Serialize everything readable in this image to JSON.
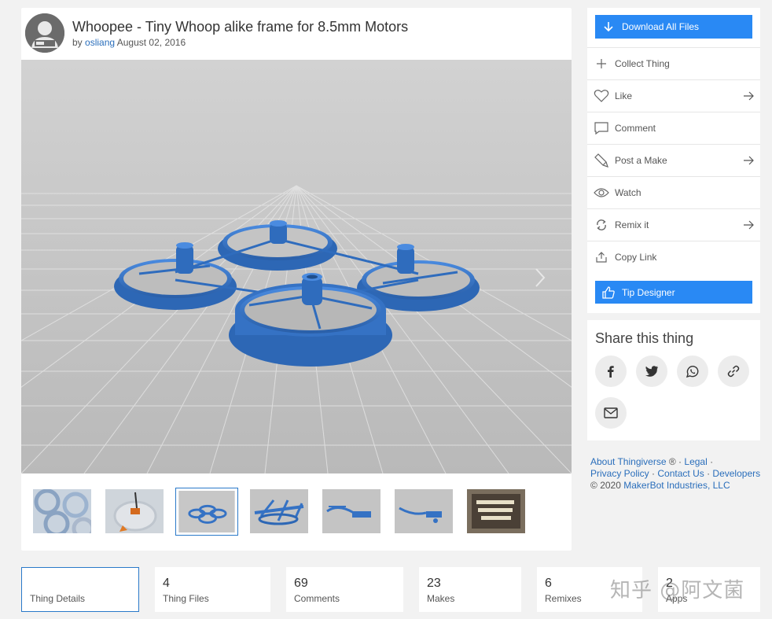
{
  "thing": {
    "title": "Whoopee - Tiny Whoop alike frame for 8.5mm Motors",
    "by_prefix": "by",
    "author": "osliang",
    "date": "August 02, 2016"
  },
  "gallery": {
    "thumbnails": [
      {
        "icon": "propeller-guards-photo"
      },
      {
        "icon": "printed-frame-photo"
      },
      {
        "icon": "frame-render",
        "active": true
      },
      {
        "icon": "frame-side-render"
      },
      {
        "icon": "part-render"
      },
      {
        "icon": "part-render-2"
      },
      {
        "icon": "text-poster-photo"
      }
    ]
  },
  "actions": {
    "download_label": "Download All Files",
    "items": [
      {
        "label": "Collect Thing",
        "icon": "plus-icon",
        "arrow": false
      },
      {
        "label": "Like",
        "icon": "heart-icon",
        "arrow": true
      },
      {
        "label": "Comment",
        "icon": "comment-icon",
        "arrow": false
      },
      {
        "label": "Post a Make",
        "icon": "make-icon",
        "arrow": true
      },
      {
        "label": "Watch",
        "icon": "eye-icon",
        "arrow": false
      },
      {
        "label": "Remix it",
        "icon": "remix-icon",
        "arrow": true
      },
      {
        "label": "Copy Link",
        "icon": "share-icon",
        "arrow": false
      }
    ],
    "tip_label": "Tip Designer"
  },
  "share": {
    "title": "Share this thing",
    "buttons": [
      "facebook-icon",
      "twitter-icon",
      "whatsapp-icon",
      "link-icon",
      "email-icon"
    ]
  },
  "footer": {
    "about": "About Thingiverse",
    "reg": "®",
    "legal": "Legal",
    "privacy": "Privacy Policy",
    "contact": "Contact Us",
    "developers": "Developers",
    "copyright_symbol": "©",
    "year": "2020",
    "company": "MakerBot Industries, LLC"
  },
  "tabs": [
    {
      "count": "",
      "label": "Thing Details",
      "active": true
    },
    {
      "count": "4",
      "label": "Thing Files"
    },
    {
      "count": "69",
      "label": "Comments"
    },
    {
      "count": "23",
      "label": "Makes"
    },
    {
      "count": "6",
      "label": "Remixes"
    },
    {
      "count": "2",
      "label": "Apps"
    }
  ],
  "watermark": "知乎 @阿文菌",
  "colors": {
    "accent": "#2989f4",
    "link": "#2a6ebb",
    "model": "#3a78c8"
  }
}
